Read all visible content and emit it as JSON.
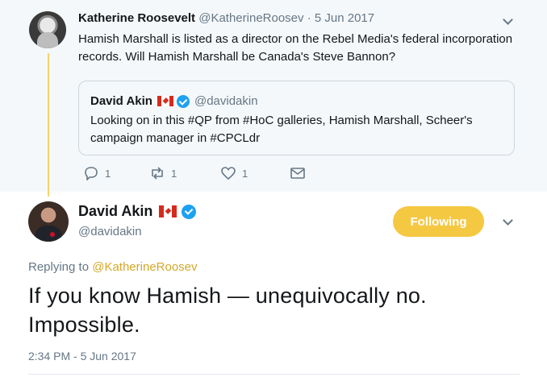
{
  "parent_tweet": {
    "author_name": "Katherine Roosevelt",
    "author_handle": "@KatherineRoosev",
    "separator": "·",
    "date": "5 Jun 2017",
    "text": "Hamish Marshall is listed as a director on the Rebel Media's federal incorporation records. Will Hamish Marshall be Canada's Steve Bannon?",
    "quoted": {
      "author_name": "David Akin",
      "author_handle": "@davidakin",
      "text": "Looking on in this #QP from #HoC galleries, Hamish Marshall, Scheer's campaign manager in #CPCLdr"
    },
    "actions": {
      "reply_count": "1",
      "retweet_count": "1",
      "like_count": "1"
    }
  },
  "main_tweet": {
    "author_name": "David Akin",
    "author_handle": "@davidakin",
    "follow_label": "Following",
    "replying_prefix": "Replying to",
    "replying_handle": "@KatherineRoosev",
    "text": "If you know Hamish — unequivocally no. Impossible.",
    "timestamp": "2:34 PM - 5 Jun 2017"
  },
  "colors": {
    "accent": "#f5c842",
    "thread_line": "#f5d46f",
    "verified": "#1da1f2",
    "muted": "#657786",
    "parent_bg": "#f5f8fa"
  },
  "icons": [
    "chevron-down-icon",
    "canada-flag-icon",
    "verified-badge-icon",
    "reply-icon",
    "retweet-icon",
    "like-icon",
    "direct-message-icon"
  ]
}
